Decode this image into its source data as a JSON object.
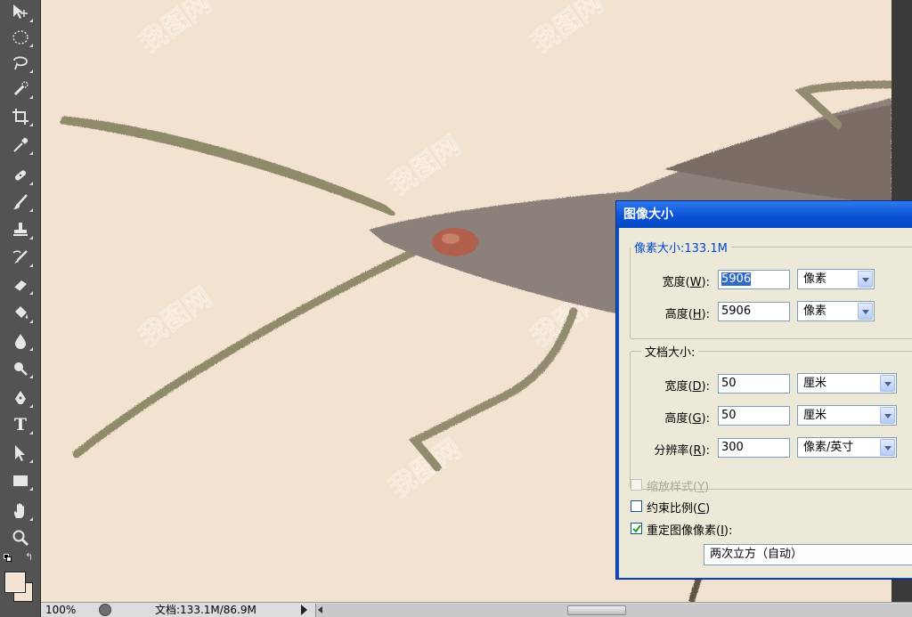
{
  "toolbar": {
    "tools": [
      {
        "name": "move-tool-icon"
      },
      {
        "name": "elliptical-marquee-tool-icon"
      },
      {
        "name": "lasso-tool-icon"
      },
      {
        "name": "quick-selection-tool-icon"
      },
      {
        "name": "crop-tool-icon"
      },
      {
        "name": "eyedropper-tool-icon"
      },
      {
        "name": "healing-brush-tool-icon"
      },
      {
        "name": "brush-tool-icon"
      },
      {
        "name": "clone-stamp-tool-icon"
      },
      {
        "name": "history-brush-tool-icon"
      },
      {
        "name": "eraser-tool-icon"
      },
      {
        "name": "paint-bucket-tool-icon"
      },
      {
        "name": "blur-tool-icon"
      },
      {
        "name": "dodge-tool-icon"
      },
      {
        "name": "pen-tool-icon"
      },
      {
        "name": "type-tool-icon"
      },
      {
        "name": "path-selection-tool-icon"
      },
      {
        "name": "rectangle-tool-icon"
      },
      {
        "name": "hand-tool-icon"
      },
      {
        "name": "zoom-tool-icon"
      }
    ],
    "type_tool_glyph": "T",
    "foreground_color": "#f3e2cf",
    "background_color": "#f3e2cf"
  },
  "canvas": {
    "background_color": "#f3e2cf",
    "watermark_text": "我图网"
  },
  "status": {
    "zoom": "100%",
    "doc_info": "文档:133.1M/86.9M"
  },
  "dialog": {
    "title": "图像大小",
    "pixel_dimensions": {
      "legend": "像素大小:133.1M",
      "width_label": "宽度(",
      "width_key": "W",
      "width_value": "5906",
      "width_unit": "像素",
      "height_label": "高度(",
      "height_key": "H",
      "height_value": "5906",
      "height_unit": "像素"
    },
    "document_size": {
      "legend": "文档大小:",
      "width_label": "宽度(",
      "width_key": "D",
      "width_value": "50",
      "width_unit": "厘米",
      "height_label": "高度(",
      "height_key": "G",
      "height_value": "50",
      "height_unit": "厘米",
      "resolution_label": "分辨率(",
      "resolution_key": "R",
      "resolution_value": "300",
      "resolution_unit": "像素/英寸"
    },
    "scale_styles": {
      "label": "缩放样式(",
      "key": "Y",
      "checked": false,
      "disabled": true
    },
    "constrain_proportions": {
      "label": "约束比例(",
      "key": "C",
      "checked": false
    },
    "resample": {
      "label": "重定图像像素(",
      "key": "I",
      "checked": true
    },
    "label_suffix": "):",
    "check_suffix": ")",
    "resample_suffix": "):",
    "interpolation": "两次立方（自动）"
  }
}
